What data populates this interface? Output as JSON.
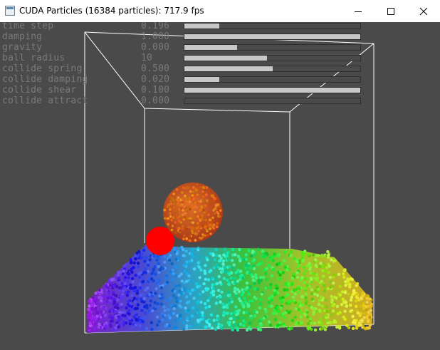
{
  "window": {
    "title": "CUDA Particles (16384 particles): 717.9 fps"
  },
  "controls": {
    "minimize_icon": "minimize-icon",
    "maximize_icon": "maximize-icon",
    "close_icon": "close-icon"
  },
  "params": [
    {
      "name": "time step",
      "value": "0.196",
      "fill": 0.2
    },
    {
      "name": "damping",
      "value": "1.000",
      "fill": 1.0
    },
    {
      "name": "gravity",
      "value": "0.000",
      "fill": 0.3
    },
    {
      "name": "ball radius",
      "value": "10",
      "fill": 0.47
    },
    {
      "name": "collide spring",
      "value": "0.500",
      "fill": 0.5
    },
    {
      "name": "collide damping",
      "value": "0.020",
      "fill": 0.2
    },
    {
      "name": "collide shear",
      "value": "0.100",
      "fill": 1.0
    },
    {
      "name": "collide attract",
      "value": "0.000",
      "fill": 0.0
    }
  ],
  "colors": {
    "background": "#4a4a4a",
    "slider_fill": "#c8c8c8",
    "label": "#7a7a7a",
    "ball_red": "#ff0000",
    "wire": "#ffffff"
  }
}
